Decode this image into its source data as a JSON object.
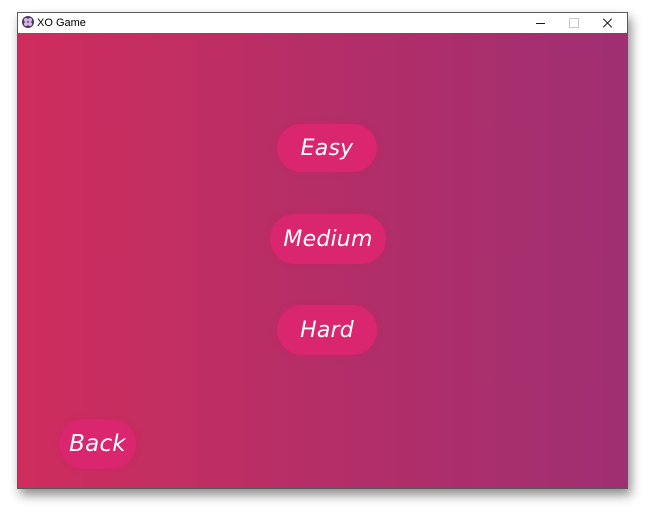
{
  "window": {
    "title": "XO Game",
    "app_icon": "xo-app-icon",
    "controls": {
      "minimize_icon": "minimize-icon",
      "maximize_icon": "maximize-icon",
      "close_icon": "close-icon"
    }
  },
  "menu": {
    "difficulty_options": [
      {
        "label": "Easy"
      },
      {
        "label": "Medium"
      },
      {
        "label": "Hard"
      }
    ],
    "back_label": "Back"
  },
  "colors": {
    "gradient_start": "#cf2d5d",
    "gradient_end": "#9f2f72",
    "button_bg": "#d9266e",
    "button_text": "#ffffff"
  }
}
